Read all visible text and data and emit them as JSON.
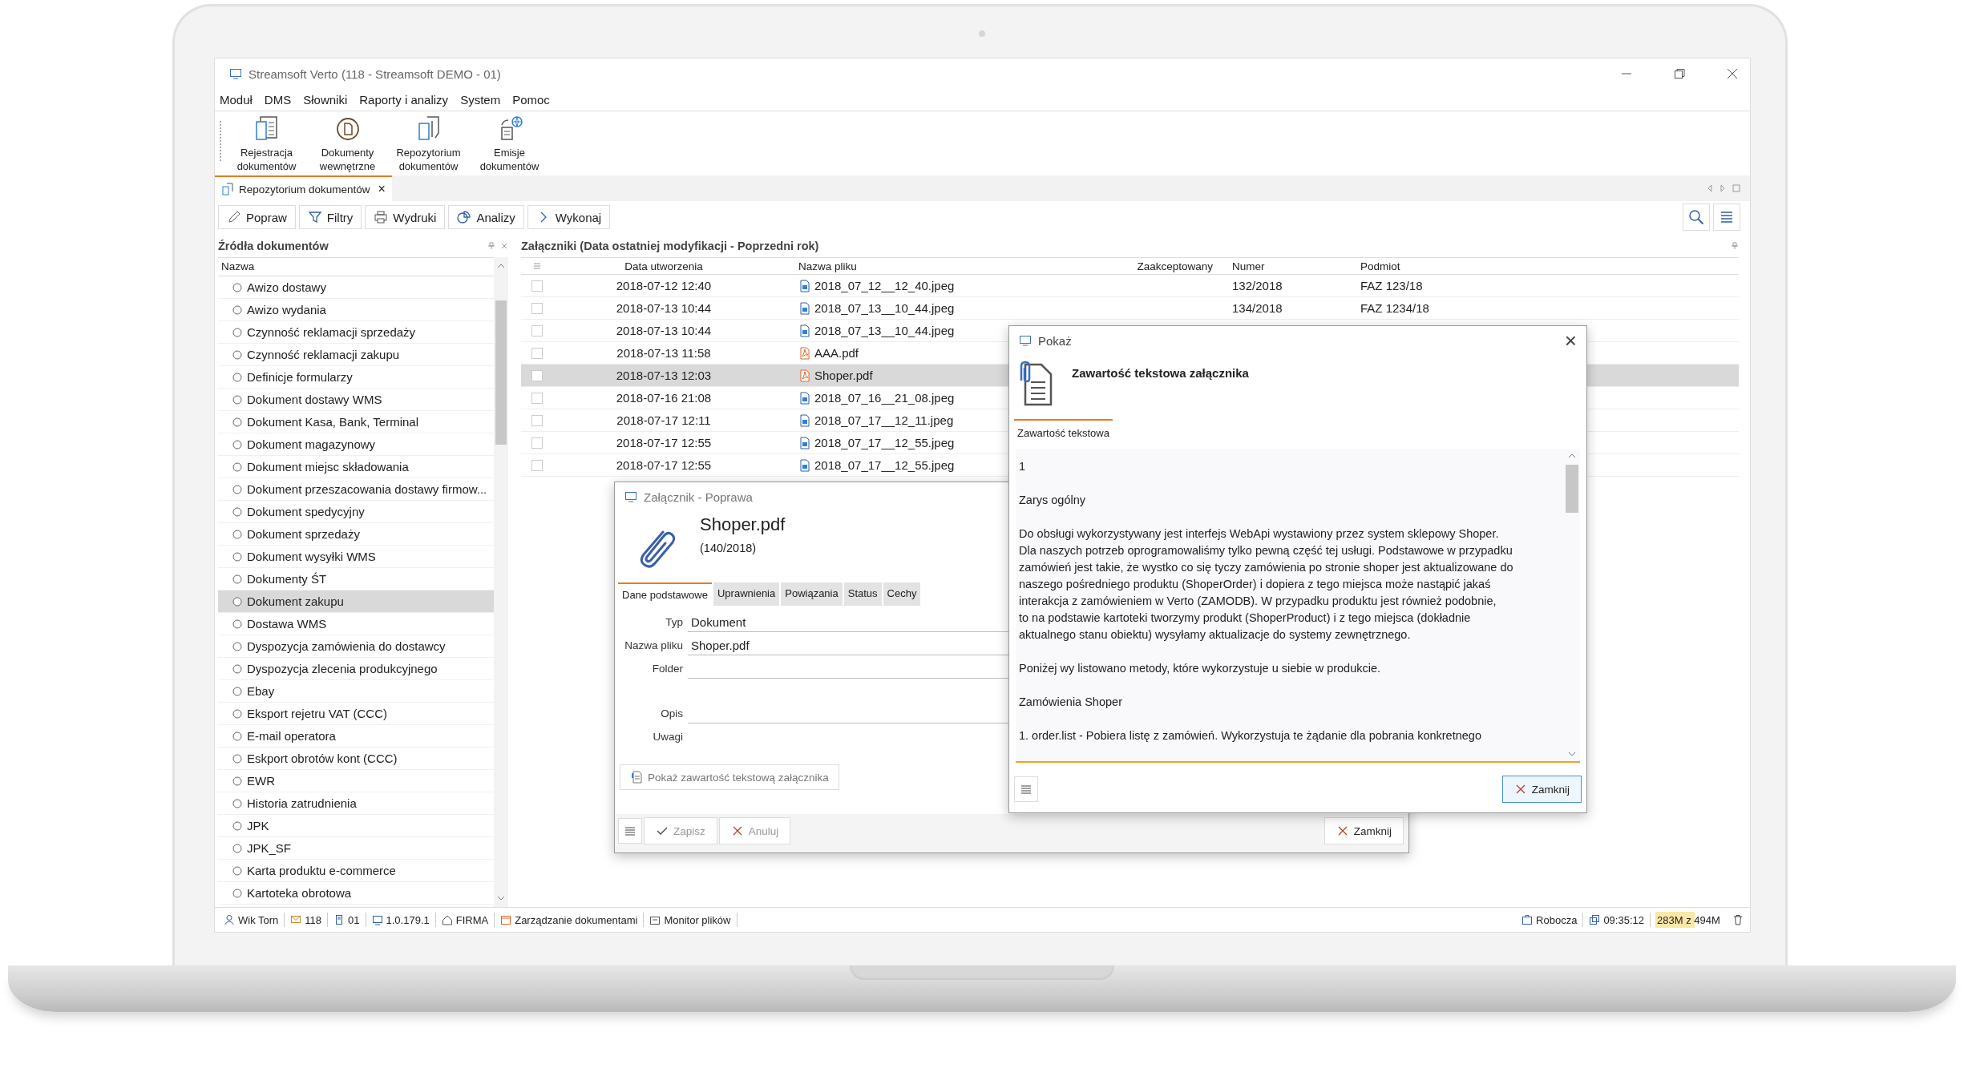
{
  "window": {
    "title": "Streamsoft Verto (118 - Streamsoft DEMO - 01)"
  },
  "menu": [
    "Moduł",
    "DMS",
    "Słowniki",
    "Raporty i analizy",
    "System",
    "Pomoc"
  ],
  "ribbon": [
    {
      "kind": "register",
      "label": "Rejestracja\ndokumentów"
    },
    {
      "kind": "internal",
      "label": "Dokumenty\nwewnętrzne"
    },
    {
      "kind": "repository",
      "label": "Repozytorium\ndokumentów"
    },
    {
      "kind": "emission",
      "label": "Emisje\ndokumentów"
    }
  ],
  "doc_tabs": [
    {
      "label": "Repozytorium dokumentów",
      "selected": true,
      "close": "×"
    }
  ],
  "toolbar": [
    {
      "kind": "edit",
      "label": "Popraw"
    },
    {
      "kind": "filter",
      "label": "Filtry"
    },
    {
      "kind": "print",
      "label": "Wydruki"
    },
    {
      "kind": "analysis",
      "label": "Analizy"
    },
    {
      "kind": "run",
      "label": "Wykonaj"
    }
  ],
  "sources": {
    "title": "Źródła dokumentów",
    "column": "Nazwa",
    "items": [
      {
        "label": "Awizo dostawy",
        "selected": false
      },
      {
        "label": "Awizo wydania",
        "selected": false
      },
      {
        "label": "Czynność reklamacji sprzedaży",
        "selected": false
      },
      {
        "label": "Czynność reklamacji zakupu",
        "selected": false
      },
      {
        "label": "Definicje formularzy",
        "selected": false
      },
      {
        "label": "Dokument dostawy WMS",
        "selected": false
      },
      {
        "label": "Dokument Kasa, Bank, Terminal",
        "selected": false
      },
      {
        "label": "Dokument magazynowy",
        "selected": false
      },
      {
        "label": "Dokument miejsc składowania",
        "selected": false
      },
      {
        "label": "Dokument przeszacowania dostawy firmow...",
        "selected": false
      },
      {
        "label": "Dokument spedycyjny",
        "selected": false
      },
      {
        "label": "Dokument sprzedaży",
        "selected": false
      },
      {
        "label": "Dokument wysyłki WMS",
        "selected": false
      },
      {
        "label": "Dokumenty ŚT",
        "selected": false
      },
      {
        "label": "Dokument zakupu",
        "selected": true
      },
      {
        "label": "Dostawa WMS",
        "selected": false
      },
      {
        "label": "Dyspozycja zamówienia do dostawcy",
        "selected": false
      },
      {
        "label": "Dyspozycja zlecenia produkcyjnego",
        "selected": false
      },
      {
        "label": "Ebay",
        "selected": false
      },
      {
        "label": "Eksport rejetru VAT (CCC)",
        "selected": false
      },
      {
        "label": "E-mail operatora",
        "selected": false
      },
      {
        "label": "Eskport obrotów kont (CCC)",
        "selected": false
      },
      {
        "label": "EWR",
        "selected": false
      },
      {
        "label": "Historia zatrudnienia",
        "selected": false
      },
      {
        "label": "JPK",
        "selected": false
      },
      {
        "label": "JPK_SF",
        "selected": false
      },
      {
        "label": "Karta produktu e-commerce",
        "selected": false
      },
      {
        "label": "Kartoteka obrotowa",
        "selected": false
      }
    ]
  },
  "attachments": {
    "title": "Załączniki (Data ostatniej modyfikacji - Poprzedni rok)",
    "columns": [
      "Data utworzenia",
      "Nazwa pliku",
      "Zaakceptowany",
      "Numer",
      "Podmiot"
    ],
    "rows": [
      {
        "checked": false,
        "selected": false,
        "date": "2018-07-12 12:40",
        "kind": "image",
        "file": "2018_07_12__12_40.jpeg",
        "number": "132/2018",
        "subject": "FAZ 123/18"
      },
      {
        "checked": false,
        "selected": false,
        "date": "2018-07-13 10:44",
        "kind": "image",
        "file": "2018_07_13__10_44.jpeg",
        "number": "134/2018",
        "subject": "FAZ 1234/18"
      },
      {
        "checked": false,
        "selected": false,
        "date": "2018-07-13 10:44",
        "kind": "image",
        "file": "2018_07_13__10_44.jpeg"
      },
      {
        "checked": false,
        "selected": false,
        "date": "2018-07-13 11:58",
        "kind": "pdf",
        "file": "AAA.pdf"
      },
      {
        "checked": false,
        "selected": true,
        "date": "2018-07-13 12:03",
        "kind": "pdf",
        "file": "Shoper.pdf"
      },
      {
        "checked": false,
        "selected": false,
        "date": "2018-07-16 21:08",
        "kind": "image",
        "file": "2018_07_16__21_08.jpeg"
      },
      {
        "checked": false,
        "selected": false,
        "date": "2018-07-17 12:11",
        "kind": "image",
        "file": "2018_07_17__12_11.jpeg"
      },
      {
        "checked": false,
        "selected": false,
        "date": "2018-07-17 12:55",
        "kind": "image",
        "file": "2018_07_17__12_55.jpeg"
      },
      {
        "checked": false,
        "selected": false,
        "date": "2018-07-17 12:55",
        "kind": "image",
        "file": "2018_07_17__12_55.jpeg"
      }
    ]
  },
  "edit_dialog": {
    "title": "Załącznik - Poprawa",
    "file_name": "Shoper.pdf",
    "file_number": "(140/2018)",
    "tabs": [
      {
        "label": "Dane podstawowe",
        "selected": true
      },
      {
        "label": "Uprawnienia",
        "selected": false
      },
      {
        "label": "Powiązania",
        "selected": false
      },
      {
        "label": "Status",
        "selected": false
      },
      {
        "label": "Cechy",
        "selected": false
      }
    ],
    "fields": [
      {
        "label": "Typ",
        "value": "Dokument"
      },
      {
        "label": "Nazwa pliku",
        "value": "Shoper.pdf"
      },
      {
        "label": "Folder"
      },
      {
        "label": "Opis"
      },
      {
        "label": "Uwagi"
      }
    ],
    "show_text_button": "Pokaż zawartość tekstową załącznika",
    "buttons": [
      {
        "kind": "save",
        "label": "Zapisz",
        "disabled": true
      },
      {
        "kind": "cancel",
        "label": "Anuluj",
        "disabled": true
      },
      {
        "kind": "close",
        "label": "Zamknij",
        "disabled": false
      }
    ]
  },
  "show_dialog": {
    "title": "Pokaż",
    "close": "×",
    "heading": "Zawartość tekstowa załącznika",
    "tabs": [
      {
        "label": "Zawartość tekstowa",
        "selected": true
      }
    ],
    "paragraphs": [
      "1",
      "Zarys ogólny",
      "Do obsługi wykorzystywany jest interfejs WebApi wystawiony przez system sklepowy Shoper.\nDla naszych potrzeb oprogramowaliśmy tylko pewną część tej usługi. Podstawowe w przypadku\nzamówień jest takie, że wystko co się tyczy zamówienia po stronie shoper jest aktualizowane do\nnaszego pośredniego produktu (ShoperOrder) i dopiera z tego miejsca może nastąpić jakaś\ninterakcja z zamówieniem w Verto (ZAMODB). W przypadku produktu jest również podobnie,\nto na podstawie kartoteki tworzymy produkt (ShoperProduct) i z tego miejsca (dokładnie\naktualnego stanu obiektu) wysyłamy aktualizacje do systemy zewnętrznego.",
      "Poniżej wy listowano metody, które wykorzystuje u siebie w produkcie.",
      "Zamówienia Shoper",
      "1. order.list - Pobiera listę z zamówień. Wykorzystuja te żądanie dla pobrania konkretnego"
    ],
    "button": "Zamknij"
  },
  "status_bar": {
    "items": [
      {
        "kind": "user",
        "label": "Wik Torn"
      },
      {
        "kind": "messages",
        "label": "118"
      },
      {
        "kind": "server",
        "label": "01"
      },
      {
        "kind": "monitor",
        "label": "1.0.179.1"
      },
      {
        "kind": "home",
        "label": "FIRMA"
      },
      {
        "kind": "calendar",
        "label": "Zarządzanie dokumentami"
      },
      {
        "kind": "folder",
        "label": "Monitor plików"
      }
    ],
    "mode": "Robocza",
    "time": "09:35:12",
    "memory": {
      "label": "283M z 494M",
      "level": 0.57
    }
  }
}
